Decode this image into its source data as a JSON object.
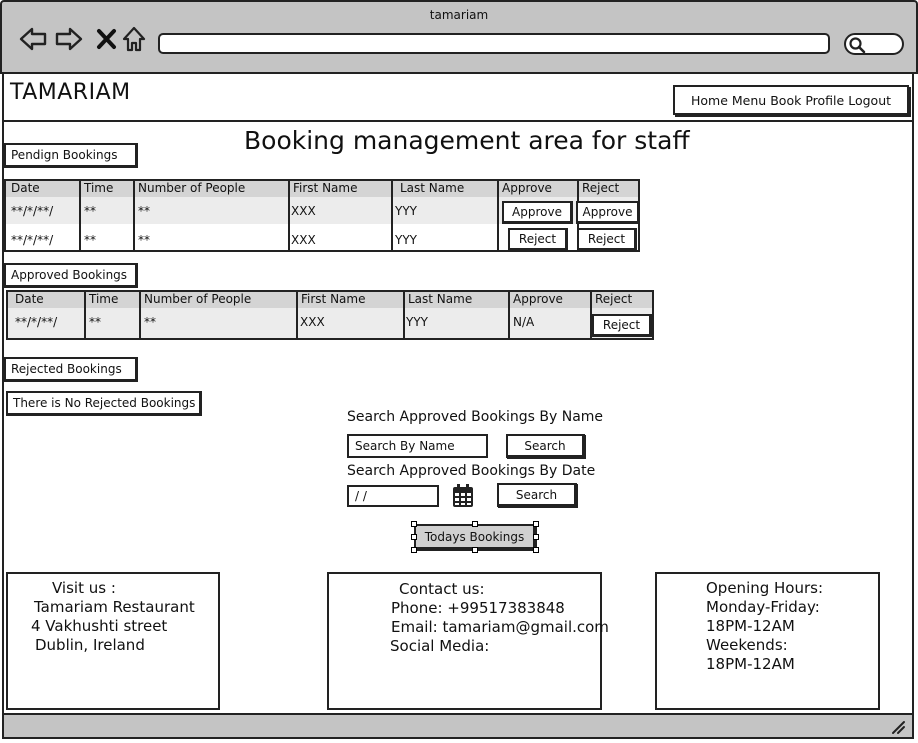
{
  "window": {
    "title": "tamariam"
  },
  "chrome_icons": [
    "back-arrow-icon",
    "forward-arrow-icon",
    "close-icon",
    "home-icon",
    "search-icon"
  ],
  "header": {
    "brand": "TAMARIAM",
    "nav": [
      "Home",
      "Menu",
      "Book",
      "Profile",
      "Logout"
    ]
  },
  "page_title": "Booking management area for staff",
  "pending": {
    "label": "Pendign Bookings",
    "columns": [
      "Date",
      "Time",
      "Number of People",
      "First Name",
      "Last Name",
      "Approve",
      "Reject"
    ],
    "rows": [
      {
        "date": "**/*/**/",
        "time": "**",
        "people": "**",
        "first": "XXX",
        "last": "YYY",
        "approve": "Approve",
        "reject": "Approve"
      },
      {
        "date": "**/*/**/",
        "time": "**",
        "people": "**",
        "first": "XXX",
        "last": "YYY",
        "approve": "Reject",
        "reject": "Reject"
      }
    ]
  },
  "approved": {
    "label": "Approved Bookings",
    "columns": [
      "Date",
      "Time",
      "Number of People",
      "First Name",
      "Last Name",
      "Approve",
      "Reject"
    ],
    "rows": [
      {
        "date": "**/*/**/",
        "time": "**",
        "people": "**",
        "first": "XXX",
        "last": "YYY",
        "approve": "N/A",
        "reject": "Reject"
      }
    ]
  },
  "rejected": {
    "label": "Rejected Bookings",
    "empty_message": "There is No Rejected Bookings"
  },
  "search": {
    "by_name_label": "Search Approved Bookings By Name",
    "name_placeholder": "Search By Name",
    "name_button": "Search",
    "by_date_label": "Search Approved Bookings By Date",
    "date_value": "/  /",
    "date_button": "Search",
    "today_button": "Todays Bookings"
  },
  "footer": {
    "visit": [
      "Visit us :",
      "Tamariam Restaurant",
      "4 Vakhushti street",
      "Dublin, Ireland"
    ],
    "contact": [
      "Contact us:",
      "Phone: +99517383848",
      "Email: tamariam@gmail.com",
      "Social Media:"
    ],
    "hours": [
      "Opening Hours:",
      "Monday-Friday:",
      "18PM-12AM",
      "Weekends:",
      "18PM-12AM"
    ]
  }
}
